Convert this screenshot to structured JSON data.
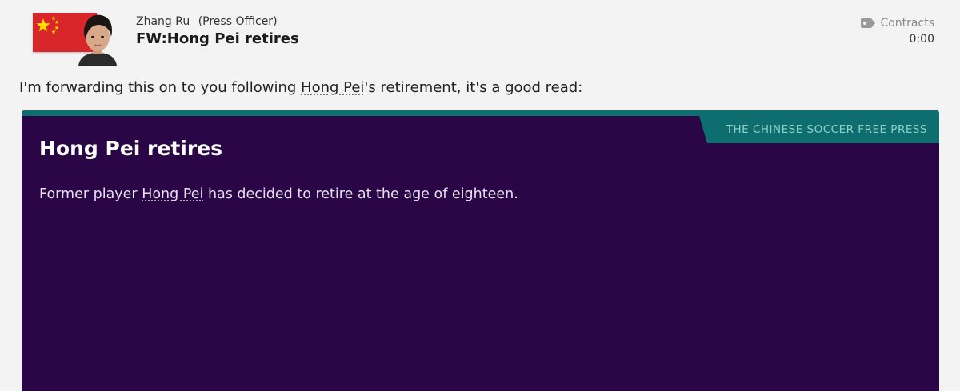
{
  "message": {
    "sender_name": "Zhang Ru",
    "sender_role": "(Press Officer)",
    "subject": "FW:Hong Pei retires",
    "category": "Contracts",
    "time": "0:00",
    "flag_icon": "china-flag-icon",
    "avatar_icon": "person-avatar-icon"
  },
  "intro": {
    "before": "I'm forwarding this on to you following ",
    "player_link": "Hong Pei",
    "after": "'s retirement, it's a good read:"
  },
  "article": {
    "publisher": "THE CHINESE SOCCER FREE PRESS",
    "headline": "Hong Pei retires",
    "text_before": "Former player ",
    "player_link": "Hong Pei",
    "text_after": " has decided to retire at the age of eighteen."
  },
  "colors": {
    "article_background": "#2a0647",
    "article_accent": "#0e6e6f",
    "publisher_text": "#8fd1c9",
    "page_background": "#f3f3f3"
  }
}
